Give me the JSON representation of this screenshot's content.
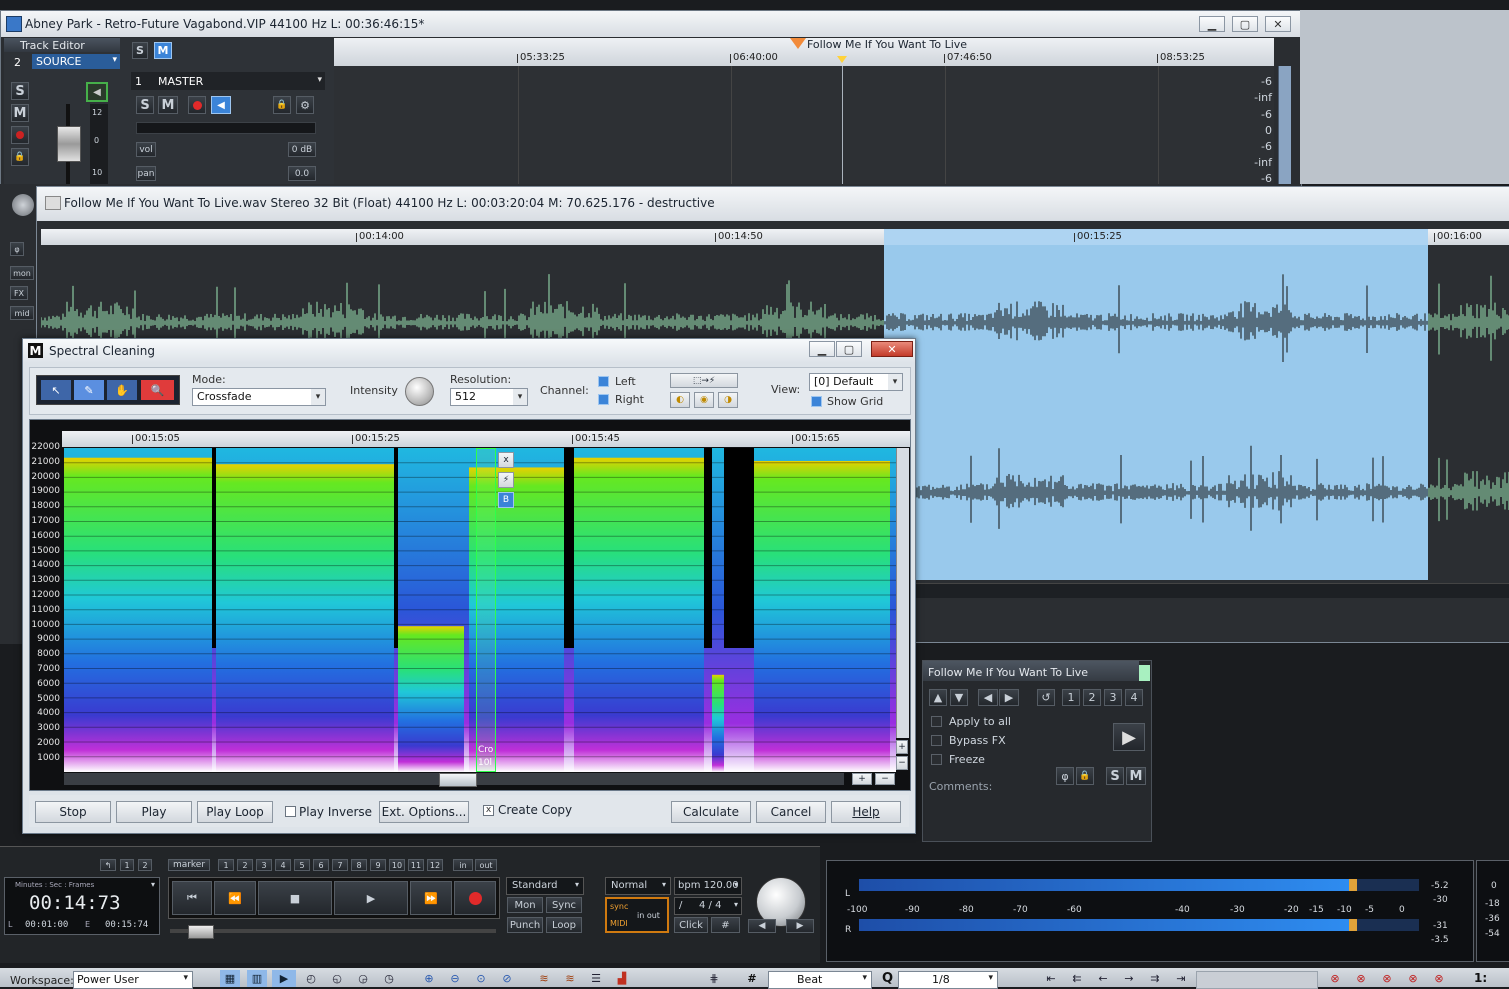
{
  "project_window": {
    "title": "Abney Park - Retro-Future Vagabond.VIP   44100 Hz L: 00:36:46:15*",
    "marker_label": "Follow Me If You Want To Live",
    "timeline": [
      "05:33:25",
      "06:40:00",
      "07:46:50",
      "08:53:25"
    ],
    "db_scale": [
      "-6",
      "-inf",
      "-6",
      "0",
      "-6",
      "-inf",
      "-6"
    ]
  },
  "track_editor": {
    "title": "Track Editor",
    "track_number": "2",
    "track_name": "SOURCE",
    "solo": "S",
    "mute": "M",
    "fader_scale": [
      "12",
      "0",
      "10"
    ],
    "side_labels": [
      "mon",
      "FX",
      "mid"
    ],
    "master": {
      "number": "1",
      "name": "MASTER",
      "vol_label": "vol",
      "vol_value": "0 dB",
      "pan_label": "pan",
      "pan_value": "0.0"
    }
  },
  "wave_window": {
    "title": "Follow Me If You Want To Live.wav  Stereo 32 Bit (Float) 44100 Hz L: 00:03:20:04 M: 70.625.176 - destructive",
    "timeline": [
      "00:14:00",
      "00:14:50",
      "00:15:25",
      "00:16:00"
    ]
  },
  "spectral_cleaning": {
    "title": "Spectral Cleaning",
    "mode_label": "Mode:",
    "mode_value": "Crossfade",
    "intensity_label": "Intensity",
    "resolution_label": "Resolution:",
    "resolution_value": "512",
    "channel_label": "Channel:",
    "channel_left": "Left",
    "channel_right": "Right",
    "view_label": "View:",
    "view_value": "[0] Default",
    "show_grid": "Show Grid",
    "timeline": [
      "00:15:05",
      "00:15:25",
      "00:15:45",
      "00:15:65"
    ],
    "freq_labels": [
      "22000",
      "21000",
      "20000",
      "19000",
      "18000",
      "17000",
      "16000",
      "15000",
      "14000",
      "13000",
      "12000",
      "11000",
      "10000",
      "9000",
      "8000",
      "7000",
      "6000",
      "5000",
      "4000",
      "3000",
      "2000",
      "1000"
    ],
    "selection_buttons": [
      "x",
      "⚡",
      "B"
    ],
    "selection_text": [
      "Cro",
      "10l"
    ],
    "buttons": {
      "stop": "Stop",
      "play": "Play",
      "play_loop": "Play Loop",
      "play_inverse": "Play Inverse",
      "ext_options": "Ext. Options...",
      "create_copy": "Create Copy",
      "calculate": "Calculate",
      "cancel": "Cancel",
      "help": "Help"
    }
  },
  "object_panel": {
    "title": "Follow Me If You Want To Live",
    "numbers": [
      "1",
      "2",
      "3",
      "4"
    ],
    "apply_to_all": "Apply to all",
    "bypass_fx": "Bypass FX",
    "freeze": "Freeze",
    "comments": "Comments:",
    "solo": "S",
    "mute": "M"
  },
  "transport": {
    "marker_label": "marker",
    "small_nums": [
      "1",
      "2"
    ],
    "marker_nums": [
      "1",
      "2",
      "3",
      "4",
      "5",
      "6",
      "7",
      "8",
      "9",
      "10",
      "11",
      "12"
    ],
    "in_label": "in",
    "out_label": "out",
    "time_format": "Minutes : Sec : Frames",
    "time_display": "00:14:73",
    "l_label": "L",
    "l_value": "00:01:00",
    "e_label": "E",
    "e_value": "00:15:74",
    "mode_select": "Standard",
    "mon": "Mon",
    "sync": "Sync",
    "punch": "Punch",
    "loop": "Loop",
    "normal_select": "Normal",
    "bpm": "bpm 120.00",
    "sig_slash": "/",
    "signature": "4 / 4",
    "click": "Click",
    "sync_label": "sync",
    "midi_label": "MIDI",
    "in_out": "in out",
    "meter_scale": [
      "-100",
      "-90",
      "-80",
      "-70",
      "-60",
      "-40",
      "-30",
      "-20",
      "-15",
      "-10",
      "-5",
      "0"
    ],
    "meter_left": "L",
    "meter_right": "R",
    "meter_values": [
      "-5.2",
      "-30",
      "-31",
      "-3.5"
    ],
    "far_values": [
      "0",
      "-18",
      "-36",
      "-54"
    ]
  },
  "statusbar": {
    "workspace_label": "Workspace:",
    "workspace_value": "Power User",
    "beat_label": "Beat",
    "quantize_value": "1/8",
    "q_label": "Q",
    "page_indicator": "1:"
  },
  "colors": {
    "selection": "#99c9ec",
    "waveform": "#9ee8b5",
    "accent_blue": "#3b84d8"
  }
}
